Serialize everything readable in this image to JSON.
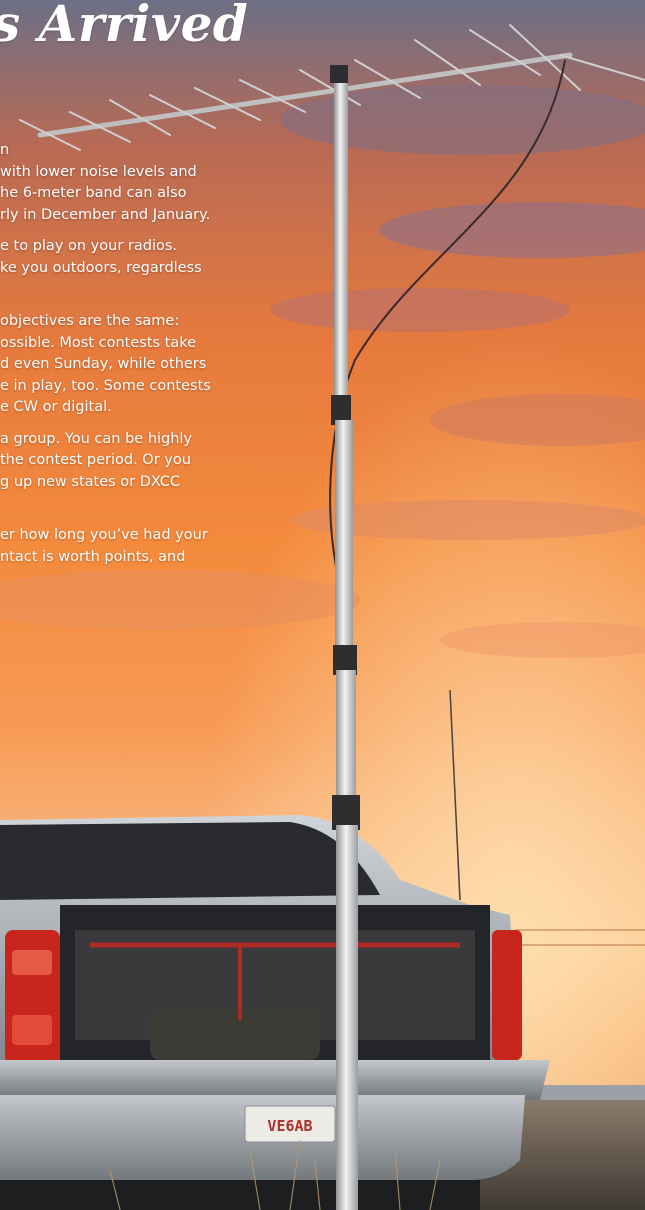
{
  "article": {
    "title": "s Arrived",
    "paragraphs": [
      [
        "n",
        "with lower noise levels and",
        "he 6-meter band can also",
        "rly in December and January."
      ],
      [
        "e to play on your radios.",
        "ke you outdoors, regardless"
      ],
      [
        "objectives are the same:",
        "ossible. Most contests take",
        "d even Sunday, while others",
        "e in play, too. Some contests",
        "e CW or digital."
      ],
      [
        "a group. You can be highly",
        "the contest period. Or you",
        "g up new states or DXCC"
      ],
      [
        "er how long you’ve had your",
        "ntact is worth points, and"
      ]
    ]
  },
  "photo": {
    "license_plate": "VE6AB"
  },
  "colors": {
    "sky_top": "#6b6f86",
    "sky_orange": "#ff8a3a",
    "sunset_glow": "#ffd29a",
    "truck_silver": "#b7bcc2",
    "taillight_red": "#c8261c",
    "text": "#ffffff"
  }
}
